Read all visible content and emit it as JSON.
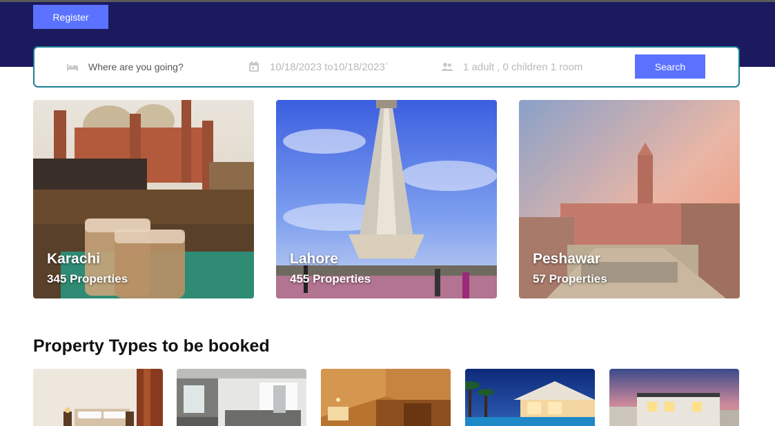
{
  "header": {
    "register_label": "Register"
  },
  "search": {
    "destination_placeholder": "Where are you going?",
    "dates": "10/18/2023 to10/18/2023`",
    "guests": "1 adult , 0 children 1 room",
    "button_label": "Search",
    "icons": [
      "bed-icon",
      "calendar-icon",
      "people-icon"
    ]
  },
  "cities": [
    {
      "name": "Karachi",
      "count": "345 Properties"
    },
    {
      "name": "Lahore",
      "count": "455 Properties"
    },
    {
      "name": "Peshawar",
      "count": "57 Properties"
    }
  ],
  "property_section": {
    "title": "Property Types to be booked"
  },
  "colors": {
    "header_bg": "#1b1a5e",
    "accent": "#5a72ff",
    "search_border": "#1f7f96"
  }
}
